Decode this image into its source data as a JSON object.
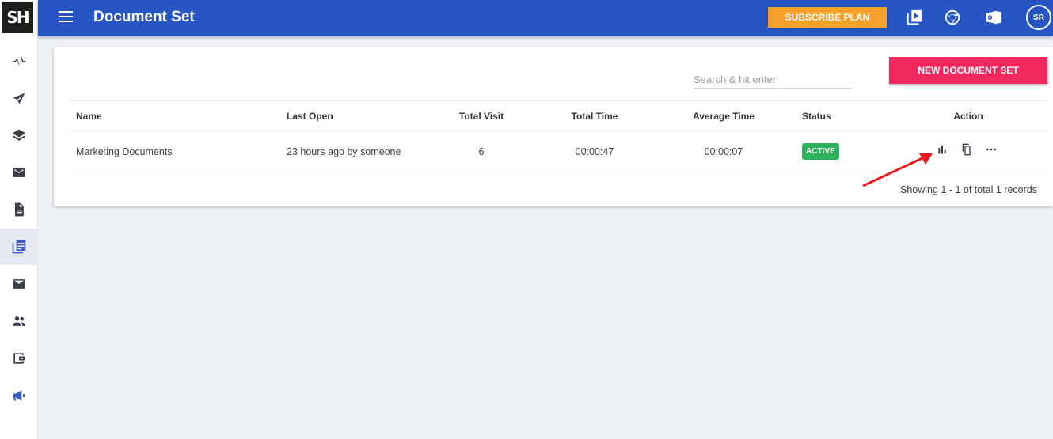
{
  "app": {
    "logo_text": "SH",
    "page_title": "Document Set"
  },
  "sidebar": {
    "items": [
      {
        "name": "activity-icon"
      },
      {
        "name": "send-icon"
      },
      {
        "name": "layers-icon"
      },
      {
        "name": "mail-icon"
      },
      {
        "name": "document-icon"
      },
      {
        "name": "document-set-icon",
        "active": true
      },
      {
        "name": "inbox-icon"
      },
      {
        "name": "people-icon"
      },
      {
        "name": "wallet-icon"
      },
      {
        "name": "megaphone-icon"
      }
    ]
  },
  "header": {
    "subscribe_label": "SUBSCRIBE PLAN",
    "icons": [
      "video-icon",
      "chrome-icon",
      "outlook-icon"
    ],
    "avatar_initials": "SR"
  },
  "toolbar": {
    "search_placeholder": "Search & hit enter",
    "new_button_label": "NEW DOCUMENT SET"
  },
  "table": {
    "columns": [
      "Name",
      "Last Open",
      "Total Visit",
      "Total Time",
      "Average Time",
      "Status",
      "Action"
    ],
    "rows": [
      {
        "name": "Marketing Documents",
        "last_open": "23 hours ago by someone",
        "total_visit": "6",
        "total_time": "00:00:47",
        "average_time": "00:00:07",
        "status": "ACTIVE",
        "actions": [
          "bar-chart-icon",
          "copy-icon",
          "more-icon"
        ]
      }
    ],
    "records_text": "Showing 1 - 1 of total 1 records"
  },
  "colors": {
    "header": "#2755c3",
    "subscribe": "#f5a02a",
    "new_button": "#f0285e",
    "status_active": "#2db35b",
    "annotation_arrow": "#e81e1e"
  }
}
